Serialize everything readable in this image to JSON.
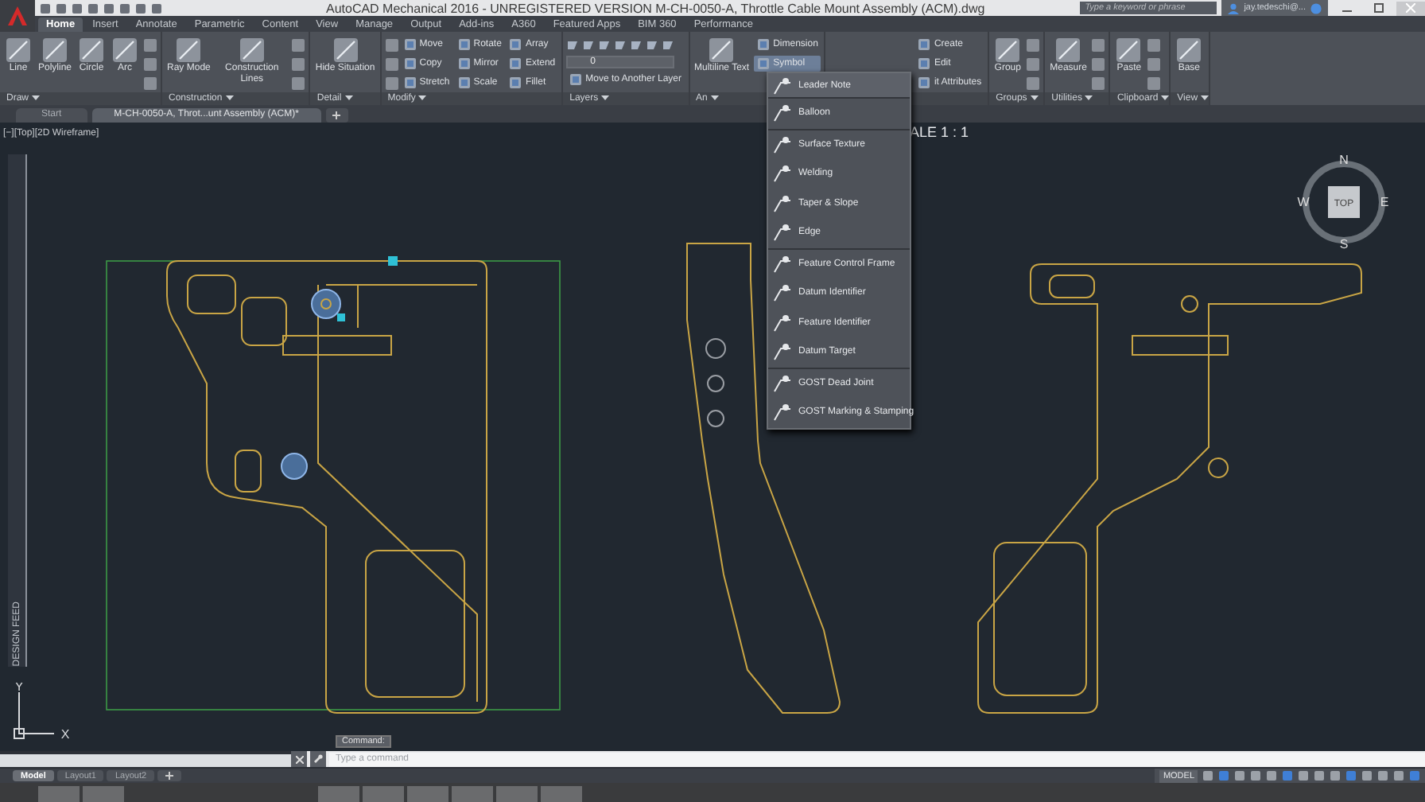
{
  "title_bar": {
    "title": "AutoCAD Mechanical 2016 - UNREGISTERED VERSION   M-CH-0050-A, Throttle Cable Mount Assembly (ACM).dwg",
    "search": {
      "placeholder": "Type a keyword or phrase"
    },
    "user": "jay.tedeschi@..."
  },
  "ribbon_tabs": [
    {
      "label": "Home",
      "selected": true
    },
    {
      "label": "Insert",
      "selected": false
    },
    {
      "label": "Annotate",
      "selected": false
    },
    {
      "label": "Parametric",
      "selected": false
    },
    {
      "label": "Content",
      "selected": false
    },
    {
      "label": "View",
      "selected": false
    },
    {
      "label": "Manage",
      "selected": false
    },
    {
      "label": "Output",
      "selected": false
    },
    {
      "label": "Add-ins",
      "selected": false
    },
    {
      "label": "A360",
      "selected": false
    },
    {
      "label": "Featured Apps",
      "selected": false
    },
    {
      "label": "BIM 360",
      "selected": false
    },
    {
      "label": "Performance",
      "selected": false
    }
  ],
  "ribbon_panels": [
    {
      "title": "Draw",
      "tools": [
        {
          "kind": "large",
          "label": "Line"
        },
        {
          "kind": "large",
          "label": "Polyline"
        },
        {
          "kind": "large",
          "label": "Circle"
        },
        {
          "kind": "large",
          "label": "Arc"
        },
        {
          "kind": "icon"
        },
        {
          "kind": "icon"
        },
        {
          "kind": "icon"
        }
      ]
    },
    {
      "title": "Construction",
      "tools": [
        {
          "kind": "large",
          "label": "Ray Mode"
        },
        {
          "kind": "large",
          "label": "Construction Lines"
        },
        {
          "kind": "icon"
        },
        {
          "kind": "icon"
        },
        {
          "kind": "icon"
        }
      ]
    },
    {
      "title": "Detail",
      "tools": [
        {
          "kind": "large",
          "label": "Hide Situation"
        }
      ]
    },
    {
      "title": "Modify",
      "tools": [
        {
          "kind": "icon"
        },
        {
          "kind": "icon"
        },
        {
          "kind": "icon"
        },
        {
          "kind": "small",
          "label": "Move"
        },
        {
          "kind": "small",
          "label": "Copy"
        },
        {
          "kind": "small",
          "label": "Stretch"
        },
        {
          "kind": "small",
          "label": "Rotate"
        },
        {
          "kind": "small",
          "label": "Mirror"
        },
        {
          "kind": "small",
          "label": "Scale"
        },
        {
          "kind": "small",
          "label": "Array"
        },
        {
          "kind": "small",
          "label": "Extend"
        },
        {
          "kind": "small",
          "label": "Fillet"
        }
      ]
    },
    {
      "title": "Layers",
      "tools": [
        {
          "kind": "dropdown",
          "value": "0"
        },
        {
          "kind": "small",
          "label": "Move to Another Layer"
        }
      ]
    },
    {
      "title": "An",
      "tools": [
        {
          "kind": "large",
          "label": "Multiline Text",
          "expanded": false
        },
        {
          "kind": "small",
          "label": "Dimension",
          "expanded": false
        },
        {
          "kind": "small",
          "label": "Symbol",
          "expanded": true
        }
      ]
    },
    {
      "tools": [
        {
          "kind": "small",
          "label": "Create"
        },
        {
          "kind": "small",
          "label": "Edit"
        },
        {
          "kind": "small",
          "label": "it Attributes"
        }
      ]
    },
    {
      "title": "Groups",
      "tools": [
        {
          "kind": "large",
          "label": "Group"
        },
        {
          "kind": "icon"
        },
        {
          "kind": "icon"
        },
        {
          "kind": "icon"
        }
      ]
    },
    {
      "title": "Utilities",
      "tools": [
        {
          "kind": "large",
          "label": "Measure"
        },
        {
          "kind": "icon"
        },
        {
          "kind": "icon"
        },
        {
          "kind": "icon"
        }
      ]
    },
    {
      "title": "Clipboard",
      "tools": [
        {
          "kind": "large",
          "label": "Paste"
        },
        {
          "kind": "icon"
        },
        {
          "kind": "icon"
        },
        {
          "kind": "icon"
        }
      ]
    },
    {
      "title": "View",
      "tools": [
        {
          "kind": "large",
          "label": "Base"
        }
      ]
    }
  ],
  "symbol_menu": {
    "sections": [
      [
        {
          "label": "Leader Note"
        }
      ],
      [
        {
          "label": "Balloon"
        }
      ],
      [
        {
          "label": "Surface Texture"
        },
        {
          "label": "Welding"
        },
        {
          "label": "Taper & Slope"
        },
        {
          "label": "Edge"
        }
      ],
      [
        {
          "label": "Feature Control Frame"
        },
        {
          "label": "Datum Identifier"
        },
        {
          "label": "Feature Identifier"
        },
        {
          "label": "Datum Target"
        }
      ],
      [
        {
          "label": "GOST Dead Joint"
        },
        {
          "label": "GOST Marking & Stamping"
        }
      ]
    ]
  },
  "file_tabs": [
    {
      "label": "Start",
      "selected": false
    },
    {
      "label": "M-CH-0050-A, Throt...unt Assembly (ACM)*",
      "selected": true
    }
  ],
  "viewport": {
    "label": "[−][Top][2D Wireframe]",
    "scale_text": "ALE 1 : 1",
    "view_cube": {
      "top": "TOP",
      "north": "N",
      "south": "S",
      "east": "E",
      "west": "W"
    },
    "side_panel": "DESIGN FEED",
    "ucs": {
      "x": "X",
      "y": "Y"
    },
    "tooltip": "Command:"
  },
  "command_line": {
    "placeholder": "Type a command"
  },
  "layout_tabs": [
    {
      "label": "Model",
      "selected": true
    },
    {
      "label": "Layout1",
      "selected": false
    },
    {
      "label": "Layout2",
      "selected": false
    }
  ],
  "status_bar": {
    "space": "MODEL"
  }
}
